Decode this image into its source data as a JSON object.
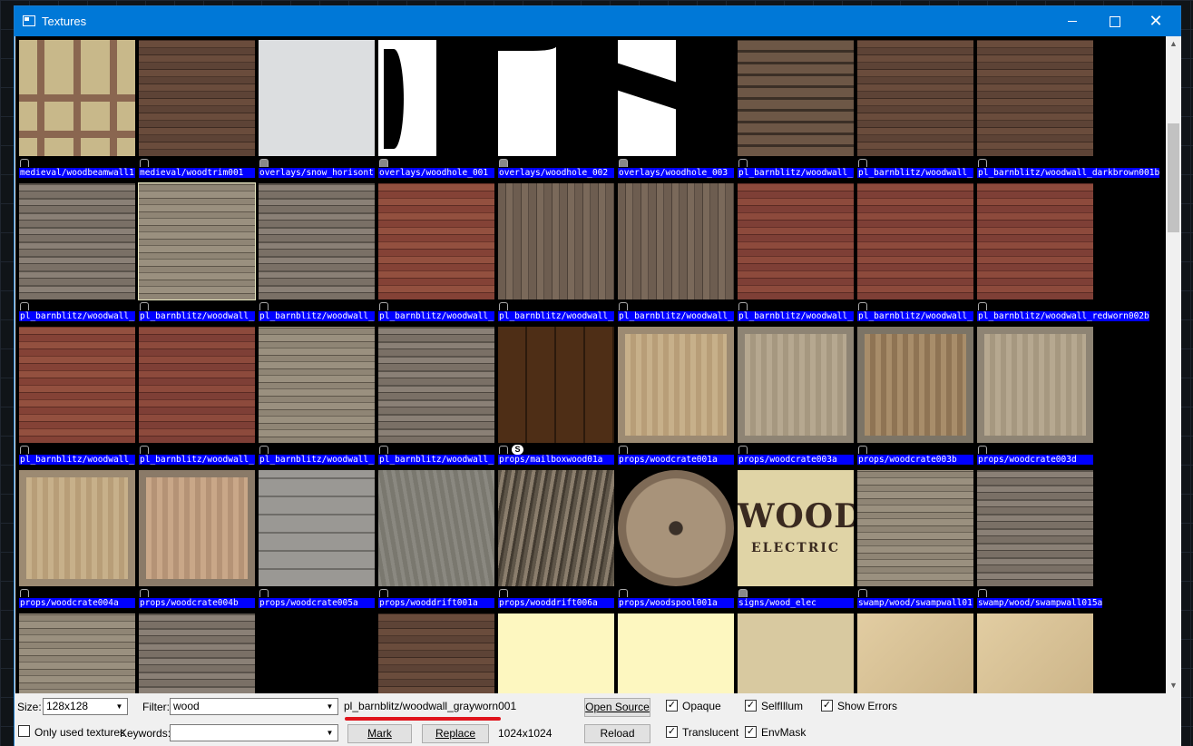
{
  "window": {
    "title": "Textures",
    "minimize_label": "",
    "maximize_label": "",
    "close_label": "✕"
  },
  "tiles": [
    {
      "label": "medieval/woodbeamwall1",
      "tex": "tudor"
    },
    {
      "label": "medieval/woodtrim001",
      "tex": "wood-br"
    },
    {
      "label": "overlays/snow_horisont",
      "tex": "snow"
    },
    {
      "label": "overlays/woodhole_001",
      "tex": "hole1"
    },
    {
      "label": "overlays/woodhole_002",
      "tex": "hole2"
    },
    {
      "label": "overlays/woodhole_003",
      "tex": "hole3"
    },
    {
      "label": "pl_barnblitz/woodwall_",
      "tex": "wood-strip"
    },
    {
      "label": "pl_barnblitz/woodwall_",
      "tex": "wood-br"
    },
    {
      "label": "pl_barnblitz/woodwall_darkbrown001b",
      "tex": "wood-br"
    },
    {
      "label": "pl_barnblitz/woodwall_",
      "tex": "wood-grey"
    },
    {
      "label": "pl_barnblitz/woodwall_",
      "tex": "wood-grey2"
    },
    {
      "label": "pl_barnblitz/woodwall_",
      "tex": "wood-grey"
    },
    {
      "label": "pl_barnblitz/woodwall_",
      "tex": "wood-red"
    },
    {
      "label": "pl_barnblitz/woodwall_",
      "tex": "wood-vert"
    },
    {
      "label": "pl_barnblitz/woodwall_",
      "tex": "wood-vert"
    },
    {
      "label": "pl_barnblitz/woodwall_",
      "tex": "wood-red2"
    },
    {
      "label": "pl_barnblitz/woodwall_",
      "tex": "wood-red2"
    },
    {
      "label": "pl_barnblitz/woodwall_redworn002b",
      "tex": "wood-red2"
    },
    {
      "label": "pl_barnblitz/woodwall_",
      "tex": "wood-red"
    },
    {
      "label": "pl_barnblitz/woodwall_",
      "tex": "wood-red2"
    },
    {
      "label": "pl_barnblitz/woodwall_",
      "tex": "wood-grey2"
    },
    {
      "label": "pl_barnblitz/woodwall_",
      "tex": "wood-grey"
    },
    {
      "label": "props/mailboxwood01a",
      "tex": "mailbox"
    },
    {
      "label": "props/woodcrate001a",
      "tex": "crate"
    },
    {
      "label": "props/woodcrate003a",
      "tex": "crate2"
    },
    {
      "label": "props/woodcrate003b",
      "tex": "crate3"
    },
    {
      "label": "props/woodcrate003d",
      "tex": "crate2"
    },
    {
      "label": "props/woodcrate004a",
      "tex": "crate"
    },
    {
      "label": "props/woodcrate004b",
      "tex": "crate4"
    },
    {
      "label": "props/woodcrate005a",
      "tex": "crate5"
    },
    {
      "label": "props/wooddrift001a",
      "tex": "drift"
    },
    {
      "label": "props/wooddrift006a",
      "tex": "drift2"
    },
    {
      "label": "props/woodspool001a",
      "tex": "spool"
    },
    {
      "label": "signs/wood_elec",
      "tex": "elec"
    },
    {
      "label": "swamp/wood/swampwall01",
      "tex": "wood-grey2"
    },
    {
      "label": "swamp/wood/swampwall015a",
      "tex": "wood-grey"
    },
    {
      "label": "",
      "tex": "wood-grey2"
    },
    {
      "label": "",
      "tex": "wood-grey"
    },
    {
      "label": "",
      "tex": "mask-b"
    },
    {
      "label": "",
      "tex": "wood-br"
    },
    {
      "label": "",
      "tex": "cream"
    },
    {
      "label": "",
      "tex": "cream"
    },
    {
      "label": "",
      "tex": "tan"
    },
    {
      "label": "",
      "tex": "beige"
    },
    {
      "label": "",
      "tex": "beige"
    }
  ],
  "sign_text": {
    "big": "WOOD",
    "small": "ELECTRIC"
  },
  "selected_index": 10,
  "scrollbar": {
    "up": "▲",
    "down": "▼"
  },
  "panel": {
    "size_label": "Size:",
    "size_value": "128x128",
    "filter_label": "Filter:",
    "filter_value": "wood",
    "only_used_label": "Only used textures",
    "only_used_checked": false,
    "keywords_label": "Keywords:",
    "keywords_value": "",
    "current_texture": "pl_barnblitz/woodwall_grayworn001",
    "dimensions": "1024x1024",
    "open_source_label": "Open Source",
    "reload_label": "Reload",
    "mark_label": "Mark",
    "replace_label": "Replace",
    "opaque_label": "Opaque",
    "translucent_label": "Translucent",
    "selfillum_label": "SelfIllum",
    "envmask_label": "EnvMask",
    "show_errors_label": "Show Errors",
    "check_mark": "✓",
    "dropdown_arrow": "▼"
  }
}
